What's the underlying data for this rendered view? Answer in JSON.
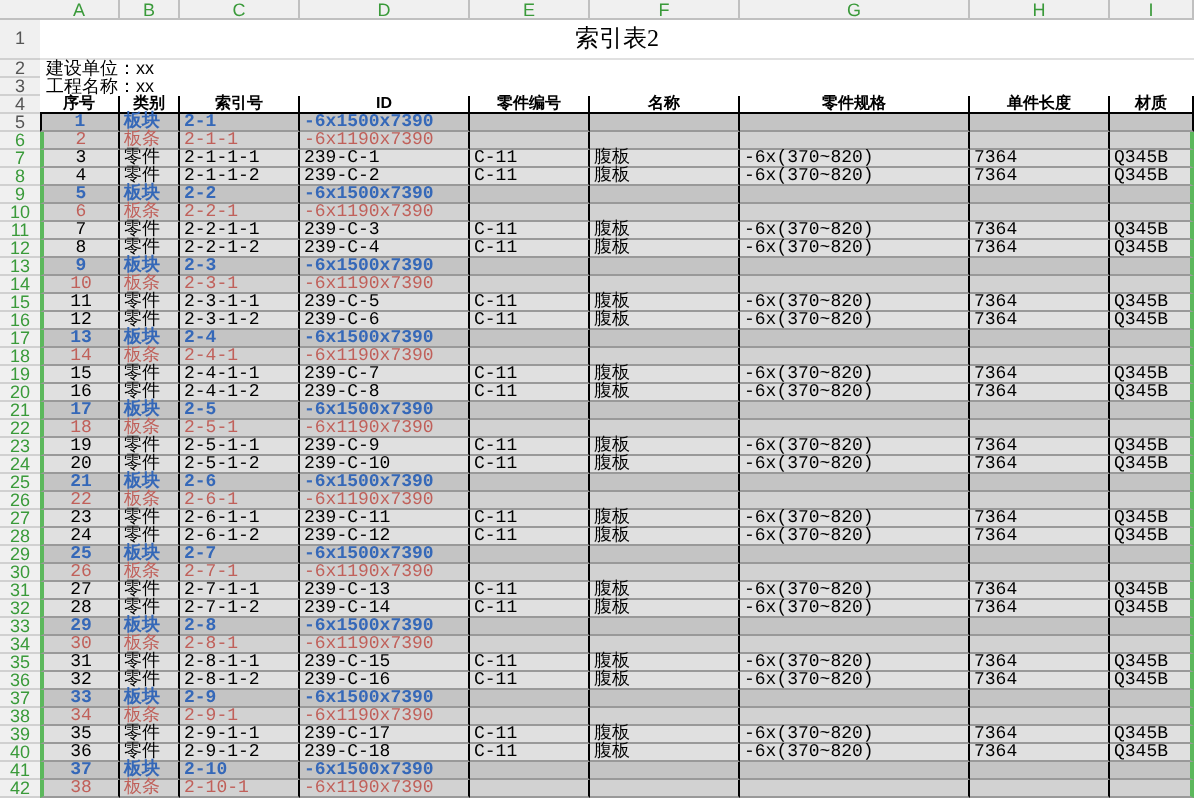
{
  "columns": [
    "A",
    "B",
    "C",
    "D",
    "E",
    "F",
    "G",
    "H",
    "I"
  ],
  "title": {
    "row": "1",
    "text": "索引表2"
  },
  "info": [
    {
      "row": "2",
      "text": "建设单位：xx"
    },
    {
      "row": "3",
      "text": "工程名称：xx"
    }
  ],
  "header": {
    "row": "4",
    "cells": [
      "序号",
      "类别",
      "索引号",
      "ID",
      "零件编号",
      "名称",
      "零件规格",
      "单件长度",
      "材质"
    ]
  },
  "rows": [
    {
      "row": "5",
      "kind": "block",
      "selected": false,
      "cells": [
        "1",
        "板块",
        "2-1",
        "-6x1500x7390"
      ]
    },
    {
      "row": "6",
      "kind": "strip",
      "selected": true,
      "cells": [
        "2",
        "板条",
        "2-1-1",
        "-6x1190x7390"
      ]
    },
    {
      "row": "7",
      "kind": "part",
      "selected": true,
      "cells": [
        "3",
        "零件",
        "2-1-1-1",
        "239-C-1",
        "C-11",
        "腹板",
        "-6x(370~820)",
        "7364",
        "Q345B"
      ]
    },
    {
      "row": "8",
      "kind": "part",
      "selected": true,
      "cells": [
        "4",
        "零件",
        "2-1-1-2",
        "239-C-2",
        "C-11",
        "腹板",
        "-6x(370~820)",
        "7364",
        "Q345B"
      ]
    },
    {
      "row": "9",
      "kind": "block",
      "selected": true,
      "cells": [
        "5",
        "板块",
        "2-2",
        "-6x1500x7390"
      ]
    },
    {
      "row": "10",
      "kind": "strip",
      "selected": true,
      "cells": [
        "6",
        "板条",
        "2-2-1",
        "-6x1190x7390"
      ]
    },
    {
      "row": "11",
      "kind": "part",
      "selected": true,
      "cells": [
        "7",
        "零件",
        "2-2-1-1",
        "239-C-3",
        "C-11",
        "腹板",
        "-6x(370~820)",
        "7364",
        "Q345B"
      ]
    },
    {
      "row": "12",
      "kind": "part",
      "selected": true,
      "cells": [
        "8",
        "零件",
        "2-2-1-2",
        "239-C-4",
        "C-11",
        "腹板",
        "-6x(370~820)",
        "7364",
        "Q345B"
      ]
    },
    {
      "row": "13",
      "kind": "block",
      "selected": true,
      "cells": [
        "9",
        "板块",
        "2-3",
        "-6x1500x7390"
      ]
    },
    {
      "row": "14",
      "kind": "strip",
      "selected": true,
      "cells": [
        "10",
        "板条",
        "2-3-1",
        "-6x1190x7390"
      ]
    },
    {
      "row": "15",
      "kind": "part",
      "selected": true,
      "cells": [
        "11",
        "零件",
        "2-3-1-1",
        "239-C-5",
        "C-11",
        "腹板",
        "-6x(370~820)",
        "7364",
        "Q345B"
      ]
    },
    {
      "row": "16",
      "kind": "part",
      "selected": true,
      "cells": [
        "12",
        "零件",
        "2-3-1-2",
        "239-C-6",
        "C-11",
        "腹板",
        "-6x(370~820)",
        "7364",
        "Q345B"
      ]
    },
    {
      "row": "17",
      "kind": "block",
      "selected": true,
      "cells": [
        "13",
        "板块",
        "2-4",
        "-6x1500x7390"
      ]
    },
    {
      "row": "18",
      "kind": "strip",
      "selected": true,
      "cells": [
        "14",
        "板条",
        "2-4-1",
        "-6x1190x7390"
      ]
    },
    {
      "row": "19",
      "kind": "part",
      "selected": true,
      "cells": [
        "15",
        "零件",
        "2-4-1-1",
        "239-C-7",
        "C-11",
        "腹板",
        "-6x(370~820)",
        "7364",
        "Q345B"
      ]
    },
    {
      "row": "20",
      "kind": "part",
      "selected": true,
      "cells": [
        "16",
        "零件",
        "2-4-1-2",
        "239-C-8",
        "C-11",
        "腹板",
        "-6x(370~820)",
        "7364",
        "Q345B"
      ]
    },
    {
      "row": "21",
      "kind": "block",
      "selected": true,
      "cells": [
        "17",
        "板块",
        "2-5",
        "-6x1500x7390"
      ]
    },
    {
      "row": "22",
      "kind": "strip",
      "selected": true,
      "cells": [
        "18",
        "板条",
        "2-5-1",
        "-6x1190x7390"
      ]
    },
    {
      "row": "23",
      "kind": "part",
      "selected": true,
      "cells": [
        "19",
        "零件",
        "2-5-1-1",
        "239-C-9",
        "C-11",
        "腹板",
        "-6x(370~820)",
        "7364",
        "Q345B"
      ]
    },
    {
      "row": "24",
      "kind": "part",
      "selected": true,
      "cells": [
        "20",
        "零件",
        "2-5-1-2",
        "239-C-10",
        "C-11",
        "腹板",
        "-6x(370~820)",
        "7364",
        "Q345B"
      ]
    },
    {
      "row": "25",
      "kind": "block",
      "selected": true,
      "cells": [
        "21",
        "板块",
        "2-6",
        "-6x1500x7390"
      ]
    },
    {
      "row": "26",
      "kind": "strip",
      "selected": true,
      "cells": [
        "22",
        "板条",
        "2-6-1",
        "-6x1190x7390"
      ]
    },
    {
      "row": "27",
      "kind": "part",
      "selected": true,
      "cells": [
        "23",
        "零件",
        "2-6-1-1",
        "239-C-11",
        "C-11",
        "腹板",
        "-6x(370~820)",
        "7364",
        "Q345B"
      ]
    },
    {
      "row": "28",
      "kind": "part",
      "selected": true,
      "cells": [
        "24",
        "零件",
        "2-6-1-2",
        "239-C-12",
        "C-11",
        "腹板",
        "-6x(370~820)",
        "7364",
        "Q345B"
      ]
    },
    {
      "row": "29",
      "kind": "block",
      "selected": true,
      "cells": [
        "25",
        "板块",
        "2-7",
        "-6x1500x7390"
      ]
    },
    {
      "row": "30",
      "kind": "strip",
      "selected": true,
      "cells": [
        "26",
        "板条",
        "2-7-1",
        "-6x1190x7390"
      ]
    },
    {
      "row": "31",
      "kind": "part",
      "selected": true,
      "cells": [
        "27",
        "零件",
        "2-7-1-1",
        "239-C-13",
        "C-11",
        "腹板",
        "-6x(370~820)",
        "7364",
        "Q345B"
      ]
    },
    {
      "row": "32",
      "kind": "part",
      "selected": true,
      "cells": [
        "28",
        "零件",
        "2-7-1-2",
        "239-C-14",
        "C-11",
        "腹板",
        "-6x(370~820)",
        "7364",
        "Q345B"
      ]
    },
    {
      "row": "33",
      "kind": "block",
      "selected": true,
      "cells": [
        "29",
        "板块",
        "2-8",
        "-6x1500x7390"
      ]
    },
    {
      "row": "34",
      "kind": "strip",
      "selected": true,
      "cells": [
        "30",
        "板条",
        "2-8-1",
        "-6x1190x7390"
      ]
    },
    {
      "row": "35",
      "kind": "part",
      "selected": true,
      "cells": [
        "31",
        "零件",
        "2-8-1-1",
        "239-C-15",
        "C-11",
        "腹板",
        "-6x(370~820)",
        "7364",
        "Q345B"
      ]
    },
    {
      "row": "36",
      "kind": "part",
      "selected": true,
      "cells": [
        "32",
        "零件",
        "2-8-1-2",
        "239-C-16",
        "C-11",
        "腹板",
        "-6x(370~820)",
        "7364",
        "Q345B"
      ]
    },
    {
      "row": "37",
      "kind": "block",
      "selected": true,
      "cells": [
        "33",
        "板块",
        "2-9",
        "-6x1500x7390"
      ]
    },
    {
      "row": "38",
      "kind": "strip",
      "selected": true,
      "cells": [
        "34",
        "板条",
        "2-9-1",
        "-6x1190x7390"
      ]
    },
    {
      "row": "39",
      "kind": "part",
      "selected": true,
      "cells": [
        "35",
        "零件",
        "2-9-1-1",
        "239-C-17",
        "C-11",
        "腹板",
        "-6x(370~820)",
        "7364",
        "Q345B"
      ]
    },
    {
      "row": "40",
      "kind": "part",
      "selected": true,
      "cells": [
        "36",
        "零件",
        "2-9-1-2",
        "239-C-18",
        "C-11",
        "腹板",
        "-6x(370~820)",
        "7364",
        "Q345B"
      ]
    },
    {
      "row": "41",
      "kind": "block",
      "selected": true,
      "cells": [
        "37",
        "板块",
        "2-10",
        "-6x1500x7390"
      ]
    },
    {
      "row": "42",
      "kind": "strip",
      "selected": true,
      "cells": [
        "38",
        "板条",
        "2-10-1",
        "-6x1190x7390"
      ]
    }
  ]
}
